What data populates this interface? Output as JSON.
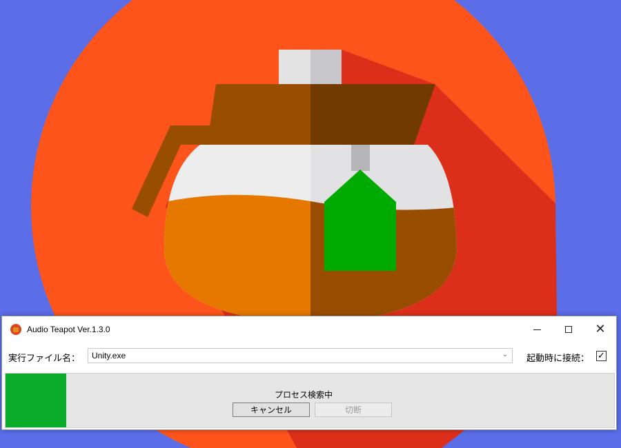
{
  "colors": {
    "desktop": "#5b6ee8",
    "circle": "#fd541b",
    "shadow": "#dc2f1a",
    "progress": "#0aaa2a"
  },
  "window": {
    "title": "Audio Teapot Ver.1.3.0",
    "app_icon": "teapot-icon",
    "minimize_icon": "minimize-icon",
    "maximize_icon": "maximize-icon",
    "close_icon": "close-icon",
    "close_glyph": "✕"
  },
  "exe": {
    "label": "実行ファイル名：",
    "value": "Unity.exe",
    "arrow": "⌄"
  },
  "startup": {
    "label": "起動時に接続：",
    "checked": true,
    "check_glyph": "✓"
  },
  "status": {
    "text": "プロセス検索中",
    "progress_fraction": 0.1,
    "cancel_label": "キャンセル",
    "disconnect_label": "切断",
    "disconnect_enabled": false
  }
}
